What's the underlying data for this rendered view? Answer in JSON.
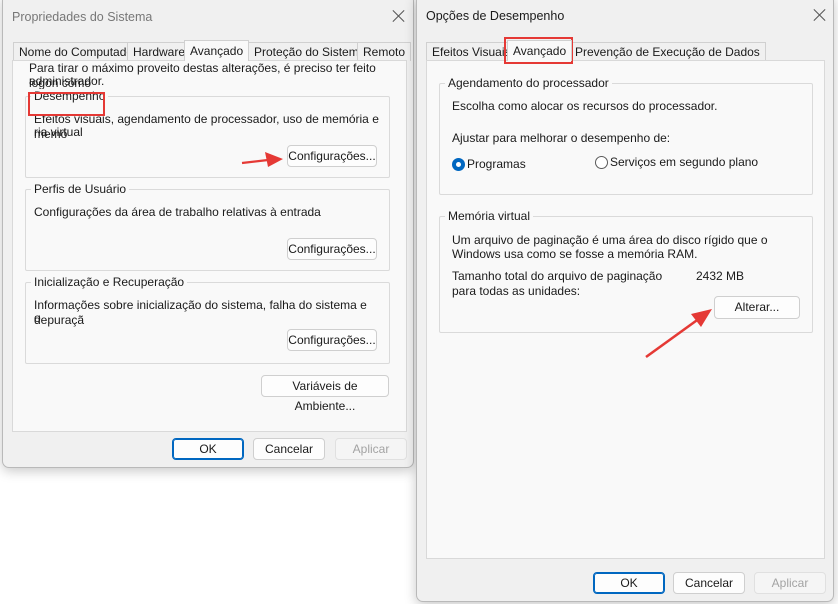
{
  "left_window": {
    "title": "Propriedades do Sistema",
    "tabs": [
      {
        "label": "Nome do Computador"
      },
      {
        "label": "Hardware"
      },
      {
        "label": "Avançado"
      },
      {
        "label": "Proteção do Sistema"
      },
      {
        "label": "Remoto"
      }
    ],
    "admin_notice": [
      "Para tirar o máximo proveito destas alterações, é preciso ter feito logon como",
      "administrador."
    ],
    "performance": {
      "title": "Desempenho",
      "description": [
        "Efeitos visuais, agendamento de processador, uso de memória e memó",
        "ria virtual"
      ],
      "button": "Configurações..."
    },
    "user_profiles": {
      "title": "Perfis de Usuário",
      "description": "Configurações da área de trabalho relativas à entrada",
      "button": "Configurações..."
    },
    "startup_recovery": {
      "title": "Inicialização e Recuperação",
      "description": [
        "Informações sobre inicialização do sistema, falha do sistema e depuraçã",
        "o"
      ],
      "button": "Configurações..."
    },
    "env_button": "Variáveis de Ambiente...",
    "ok": "OK",
    "cancel": "Cancelar",
    "apply": "Aplicar"
  },
  "right_window": {
    "title": "Opções de Desempenho",
    "tabs": [
      {
        "label": "Efeitos Visuais"
      },
      {
        "label": "Avançado"
      },
      {
        "label": "Prevenção de Execução de Dados"
      }
    ],
    "processor": {
      "title": "Agendamento do processador",
      "description": "Escolha como alocar os recursos do processador.",
      "adjust_label": "Ajustar para melhorar o desempenho de:",
      "options": [
        {
          "label": "Programas",
          "checked": true
        },
        {
          "label": "Serviços em segundo plano",
          "checked": false
        }
      ]
    },
    "virtual_memory": {
      "title": "Memória virtual",
      "description": [
        "Um arquivo de paginação é uma área do disco rígido que o",
        "Windows usa como se fosse a memória RAM."
      ],
      "total_label": [
        "Tamanho total do arquivo de paginação",
        "para todas as unidades:"
      ],
      "total_value": "2432 MB",
      "button": "Alterar..."
    },
    "ok": "OK",
    "cancel": "Cancelar",
    "apply": "Aplicar"
  },
  "highlight_color": "#e53935",
  "icons": [
    "close-icon",
    "arrow-pointer"
  ]
}
